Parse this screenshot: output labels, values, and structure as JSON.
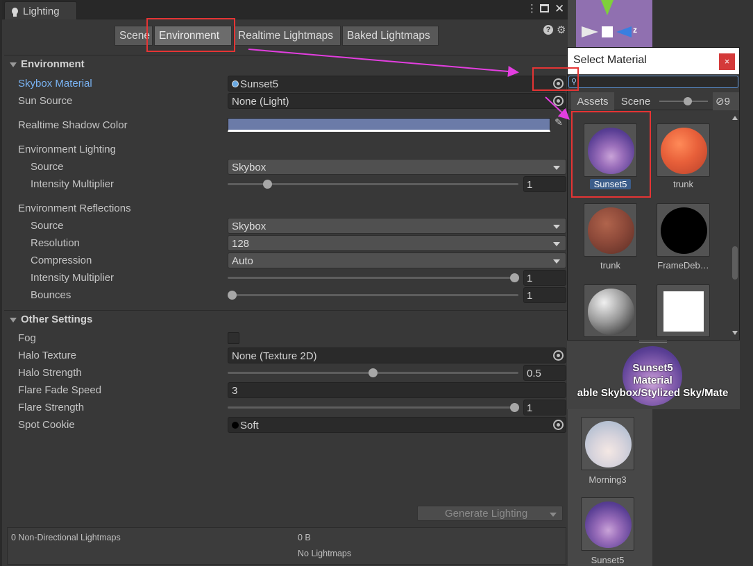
{
  "window": {
    "tab_title": "Lighting",
    "menu_icon": "kebab-icon",
    "maximize_icon": "maximize-icon",
    "close_icon": "close-icon"
  },
  "toolbar": {
    "tabs": [
      "Scene",
      "Environment",
      "Realtime Lightmaps",
      "Baked Lightmaps"
    ],
    "selected_tab": "Environment",
    "help_icon": "help-icon",
    "settings_icon": "gear-icon"
  },
  "environment": {
    "header": "Environment",
    "skybox_label": "Skybox Material",
    "skybox_value": "Sunset5",
    "sun_label": "Sun Source",
    "sun_value": "None (Light)",
    "shadow_label": "Realtime Shadow Color",
    "shadow_color": "#6b7ba8",
    "lighting_header": "Environment Lighting",
    "lighting_source_label": "Source",
    "lighting_source_value": "Skybox",
    "lighting_intensity_label": "Intensity Multiplier",
    "lighting_intensity_value": "1",
    "reflections_header": "Environment Reflections",
    "refl_source_label": "Source",
    "refl_source_value": "Skybox",
    "refl_resolution_label": "Resolution",
    "refl_resolution_value": "128",
    "refl_compression_label": "Compression",
    "refl_compression_value": "Auto",
    "refl_intensity_label": "Intensity Multiplier",
    "refl_intensity_value": "1",
    "refl_bounces_label": "Bounces",
    "refl_bounces_value": "1"
  },
  "other": {
    "header": "Other Settings",
    "fog_label": "Fog",
    "halo_texture_label": "Halo Texture",
    "halo_texture_value": "None (Texture 2D)",
    "halo_strength_label": "Halo Strength",
    "halo_strength_value": "0.5",
    "flare_fade_label": "Flare Fade Speed",
    "flare_fade_value": "3",
    "flare_strength_label": "Flare Strength",
    "flare_strength_value": "1",
    "spot_cookie_label": "Spot Cookie",
    "spot_cookie_value": "Soft"
  },
  "footer": {
    "generate_label": "Generate Lighting",
    "lightmaps_label": "0 Non-Directional Lightmaps",
    "size_value": "0 B",
    "status": "No Lightmaps"
  },
  "select_material": {
    "title": "Select Material",
    "close": "×",
    "search_placeholder": "",
    "tabs": [
      "Assets",
      "Scene"
    ],
    "hidden_count": "9",
    "items": [
      "Sunset5",
      "trunk",
      "trunk",
      "FrameDeb…"
    ],
    "preview_name": "Sunset5",
    "preview_type": "Material",
    "preview_shader": "able Skybox/Stylized Sky/Mate"
  },
  "scene_behind": {
    "gizmo_axis": "z",
    "items": [
      "Morning3",
      "Sunset5"
    ]
  }
}
